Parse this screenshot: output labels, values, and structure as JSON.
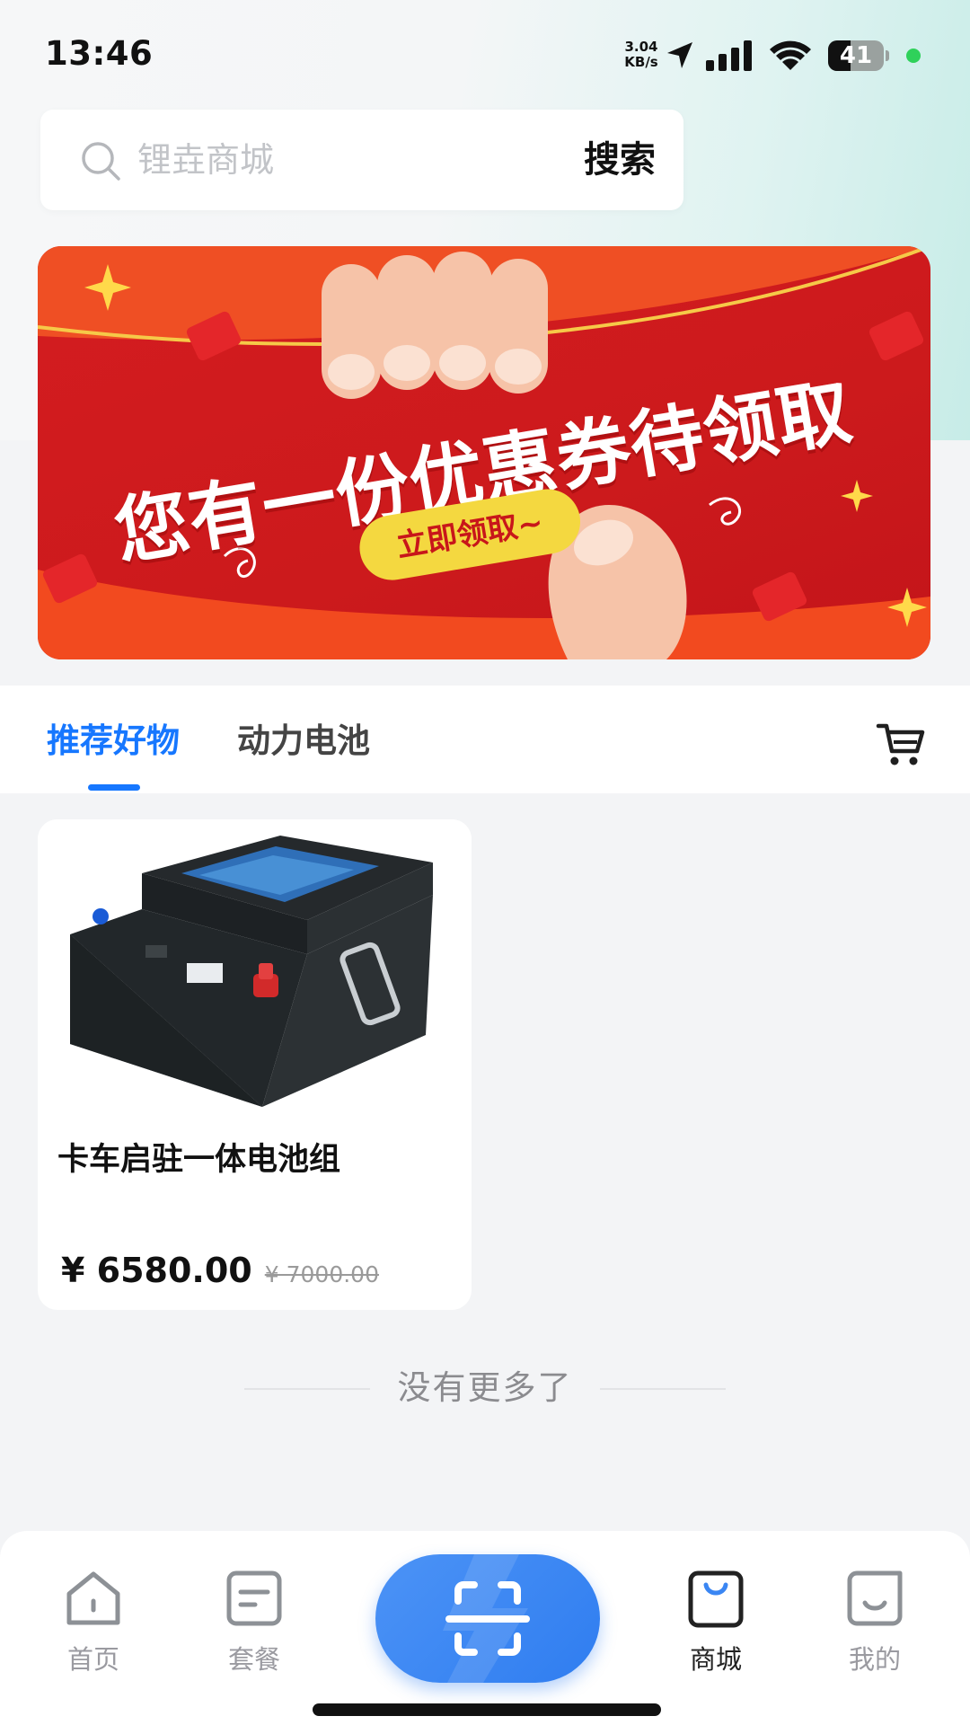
{
  "status_bar": {
    "time": "13:46",
    "net_speed_value": "3.04",
    "net_speed_unit": "KB/s",
    "battery_level": "41",
    "battery_fraction": 0.41,
    "icons": [
      "location-arrow-icon",
      "cellular-signal-icon",
      "wifi-icon",
      "battery-icon",
      "privacy-indicator-dot"
    ]
  },
  "search": {
    "placeholder": "锂垚商城",
    "button_label": "搜索",
    "icon": "search-icon"
  },
  "banner": {
    "headline": "您有一份优惠券待领取",
    "cta_label": "立即领取~",
    "slide_count": 2,
    "active_slide": 1,
    "colors": {
      "background": "#d41c20",
      "cta": "#f4d840",
      "active_dot": "#ffffff",
      "inactive_dot": "#f07a86"
    }
  },
  "tabs": {
    "items": [
      {
        "label": "推荐好物",
        "active": true
      },
      {
        "label": "动力电池",
        "active": false
      }
    ],
    "cart_icon": "cart-icon",
    "accent_color": "#1677ff"
  },
  "products": [
    {
      "title": "卡车启驻一体电池组",
      "price": "¥ 6580.00",
      "original_price": "¥ 7000.00"
    }
  ],
  "list_end_text": "没有更多了",
  "bottom_nav": {
    "items": [
      {
        "label": "首页",
        "icon": "home-icon",
        "active": false
      },
      {
        "label": "套餐",
        "icon": "package-icon",
        "active": false
      },
      {
        "label": "商城",
        "icon": "shopping-bag-icon",
        "active": true
      },
      {
        "label": "我的",
        "icon": "profile-icon",
        "active": false
      }
    ],
    "center_button_icon": "scan-icon",
    "center_button_color": "#3a86f3"
  }
}
